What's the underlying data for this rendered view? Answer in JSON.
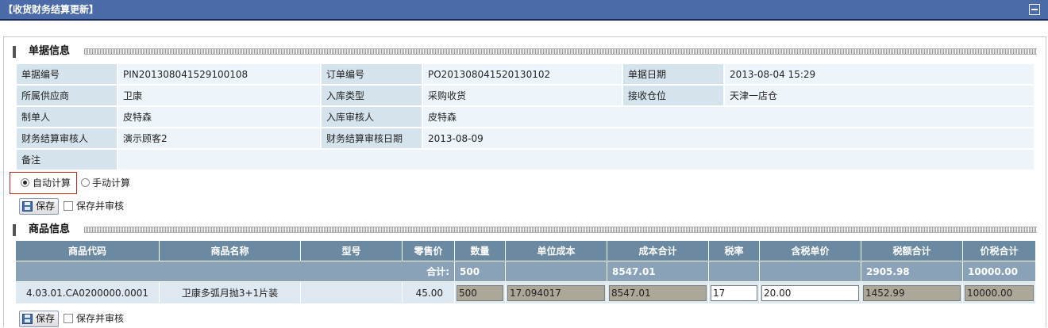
{
  "title": "【收货财务结算更新】",
  "bill_section": {
    "label": "单据信息"
  },
  "info": {
    "bill_no_label": "单据编号",
    "bill_no": "PIN201308041529100108",
    "order_no_label": "订单编号",
    "order_no": "PO201308041520130102",
    "bill_date_label": "单据日期",
    "bill_date": "2013-08-04 15:29",
    "supplier_label": "所属供应商",
    "supplier": "卫康",
    "in_type_label": "入库类型",
    "in_type": "采购收货",
    "warehouse_label": "接收仓位",
    "warehouse": "天津一店仓",
    "maker_label": "制单人",
    "maker": "皮特森",
    "in_reviewer_label": "入库审核人",
    "in_reviewer": "皮特森",
    "fin_reviewer_label": "财务结算审核人",
    "fin_reviewer": "演示顾客2",
    "fin_review_date_label": "财务结算审核日期",
    "fin_review_date": "2013-08-09",
    "remark_label": "备注",
    "remark": ""
  },
  "calc": {
    "auto_label": "自动计算",
    "manual_label": "手动计算",
    "selected": "auto"
  },
  "actions": {
    "save_label": "保存",
    "save_review_label": "保存并审核"
  },
  "goods_section": {
    "label": "商品信息"
  },
  "goods": {
    "headers": [
      "商品代码",
      "商品名称",
      "型号",
      "零售价",
      "数量",
      "单位成本",
      "成本合计",
      "税率",
      "含税单价",
      "税额合计",
      "价税合计"
    ],
    "summary": {
      "label": "合计:",
      "qty": "500",
      "cost_total": "8547.01",
      "tax_total": "2905.98",
      "price_tax_total": "10000.00"
    },
    "row": {
      "code": "4.03.01.CA0200000.0001",
      "name": "卫康多弧月抛3+1片装",
      "model": "",
      "retail": "45.00",
      "qty": "500",
      "unit_cost": "17.094017",
      "cost_total": "8547.01",
      "tax_rate": "17",
      "tax_price": "20.00",
      "tax_total": "1452.99",
      "price_tax_total": "10000.00"
    }
  }
}
